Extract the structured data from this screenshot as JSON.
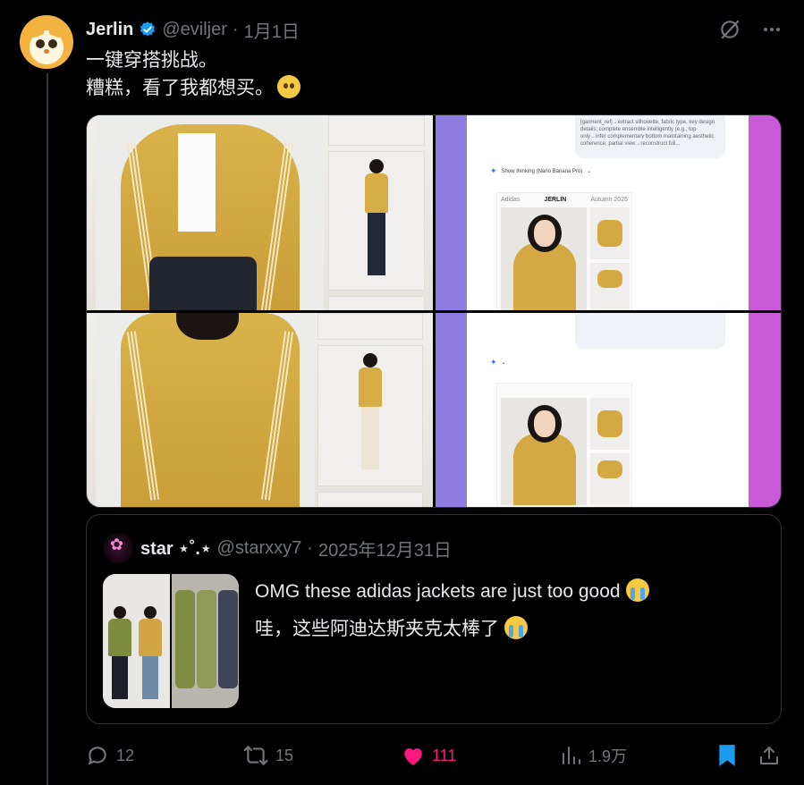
{
  "post": {
    "author_name": "Jerlin",
    "author_handle": "@eviljer",
    "separator": "·",
    "date": "1月1日",
    "line1": "一键穿搭挑战。",
    "line2": "糟糕，看了我都想买。"
  },
  "media": {
    "chat_ui": {
      "bubble_text": "[garment_ref]→extract silhouette, fabric type, key design details; complete ensemble intelligently (e.g., top only→infer complementary bottom maintaining aesthetic coherence; partial view→reconstruct full...",
      "thinking_label": "Show thinking (Nano Banana Pro)",
      "brand_left": "Adidas",
      "brand_center": "JERLIN",
      "brand_right": "Autumn 2025"
    }
  },
  "quote": {
    "author_name": "star ⋆˚.⋆",
    "author_handle": "@starxxy7",
    "separator": "·",
    "date": "2025年12月31日",
    "line1": "OMG these adidas jackets are just too good",
    "line2": "哇，这些阿迪达斯夹克太棒了"
  },
  "actions": {
    "replies": "12",
    "reposts": "15",
    "likes": "111",
    "views": "1.9万"
  },
  "colors": {
    "background": "#000000",
    "text_primary": "#e7e9ea",
    "text_secondary": "#71767b",
    "like_pink": "#f91880",
    "bookmark_blue": "#1d9bf0",
    "verified_blue": "#1d9bf0"
  },
  "icons": {
    "verified": "verified-badge-icon",
    "grok": "grok-icon",
    "more": "more-icon",
    "reply": "reply-icon",
    "repost": "repost-icon",
    "like": "heart-filled-icon",
    "views": "analytics-icon",
    "bookmark": "bookmark-filled-icon",
    "share": "share-icon"
  }
}
